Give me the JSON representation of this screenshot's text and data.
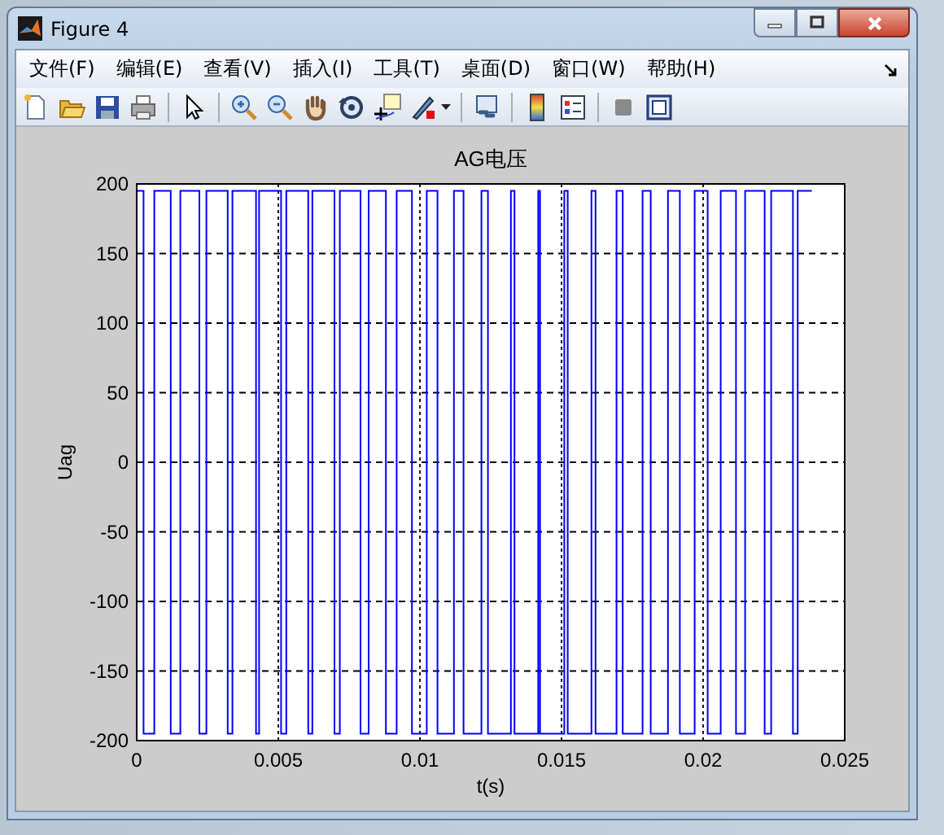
{
  "window": {
    "title": "Figure 4"
  },
  "menu": [
    {
      "label": "文件(F)"
    },
    {
      "label": "编辑(E)"
    },
    {
      "label": "查看(V)"
    },
    {
      "label": "插入(I)"
    },
    {
      "label": "工具(T)"
    },
    {
      "label": "桌面(D)"
    },
    {
      "label": "窗口(W)"
    },
    {
      "label": "帮助(H)"
    }
  ],
  "figure": {
    "chart_data": {
      "type": "line",
      "grid": true,
      "title": "AG电压",
      "xlabel": "t(s)",
      "ylabel": "Uag",
      "xlim": [
        0,
        0.025
      ],
      "ylim": [
        -200,
        200
      ],
      "xticks": [
        0,
        0.005,
        0.01,
        0.015,
        0.02,
        0.025
      ],
      "yticks": [
        -200,
        -150,
        -100,
        -50,
        0,
        50,
        100,
        150,
        200
      ],
      "x": [
        0,
        0.00024,
        0.00024,
        0.00062,
        0.00062,
        0.0012,
        0.0012,
        0.00154,
        0.00154,
        0.00221,
        0.00221,
        0.00246,
        0.00246,
        0.00321,
        0.00321,
        0.00338,
        0.00338,
        0.00421,
        0.00421,
        0.00432,
        0.00432,
        0.0051,
        0.0051,
        0.00528,
        0.00528,
        0.00606,
        0.00606,
        0.0062,
        0.0062,
        0.00698,
        0.00698,
        0.00717,
        0.00717,
        0.0079,
        0.0079,
        0.00819,
        0.00819,
        0.0088,
        0.0088,
        0.00918,
        0.00918,
        0.00972,
        0.00972,
        0.01024,
        0.01024,
        0.01062,
        0.01062,
        0.0112,
        0.0112,
        0.01154,
        0.01154,
        0.01217,
        0.01217,
        0.0124,
        0.0124,
        0.01321,
        0.01321,
        0.01334,
        0.01334,
        0.01418,
        0.01418,
        0.01424,
        0.01424,
        0.0151,
        0.0151,
        0.01522,
        0.01522,
        0.01606,
        0.01606,
        0.0162,
        0.0162,
        0.01694,
        0.01694,
        0.01716,
        0.01716,
        0.01786,
        0.01786,
        0.01815,
        0.01815,
        0.01876,
        0.01876,
        0.01918,
        0.01918,
        0.0197,
        0.0197,
        0.02016,
        0.02016,
        0.02062,
        0.02062,
        0.02116,
        0.02116,
        0.02148,
        0.02148,
        0.02217,
        0.02217,
        0.0224,
        0.0224,
        0.02317,
        0.02317,
        0.02334,
        0.02334,
        0.02384
      ],
      "series": [
        {
          "color": "#0000ff",
          "values": [
            195,
            195,
            -195,
            -195,
            195,
            195,
            -195,
            -195,
            195,
            195,
            -195,
            -195,
            195,
            195,
            -195,
            -195,
            195,
            195,
            -195,
            -195,
            195,
            195,
            -195,
            -195,
            195,
            195,
            -195,
            -195,
            195,
            195,
            -195,
            -195,
            195,
            195,
            -195,
            -195,
            195,
            195,
            -195,
            -195,
            195,
            195,
            -195,
            -195,
            195,
            195,
            -195,
            -195,
            195,
            195,
            -195,
            -195,
            195,
            195,
            -195,
            -195,
            195,
            195,
            -195,
            -195,
            195,
            195,
            -195,
            -195,
            195,
            195,
            -195,
            -195,
            195,
            195,
            -195,
            -195,
            195,
            195,
            -195,
            -195,
            195,
            195,
            -195,
            -195,
            195,
            195,
            -195,
            -195,
            195,
            195,
            -195,
            -195,
            195,
            195,
            -195,
            -195,
            195,
            195,
            -195,
            -195,
            195,
            195,
            -195,
            -195,
            195,
            195
          ]
        }
      ]
    }
  }
}
